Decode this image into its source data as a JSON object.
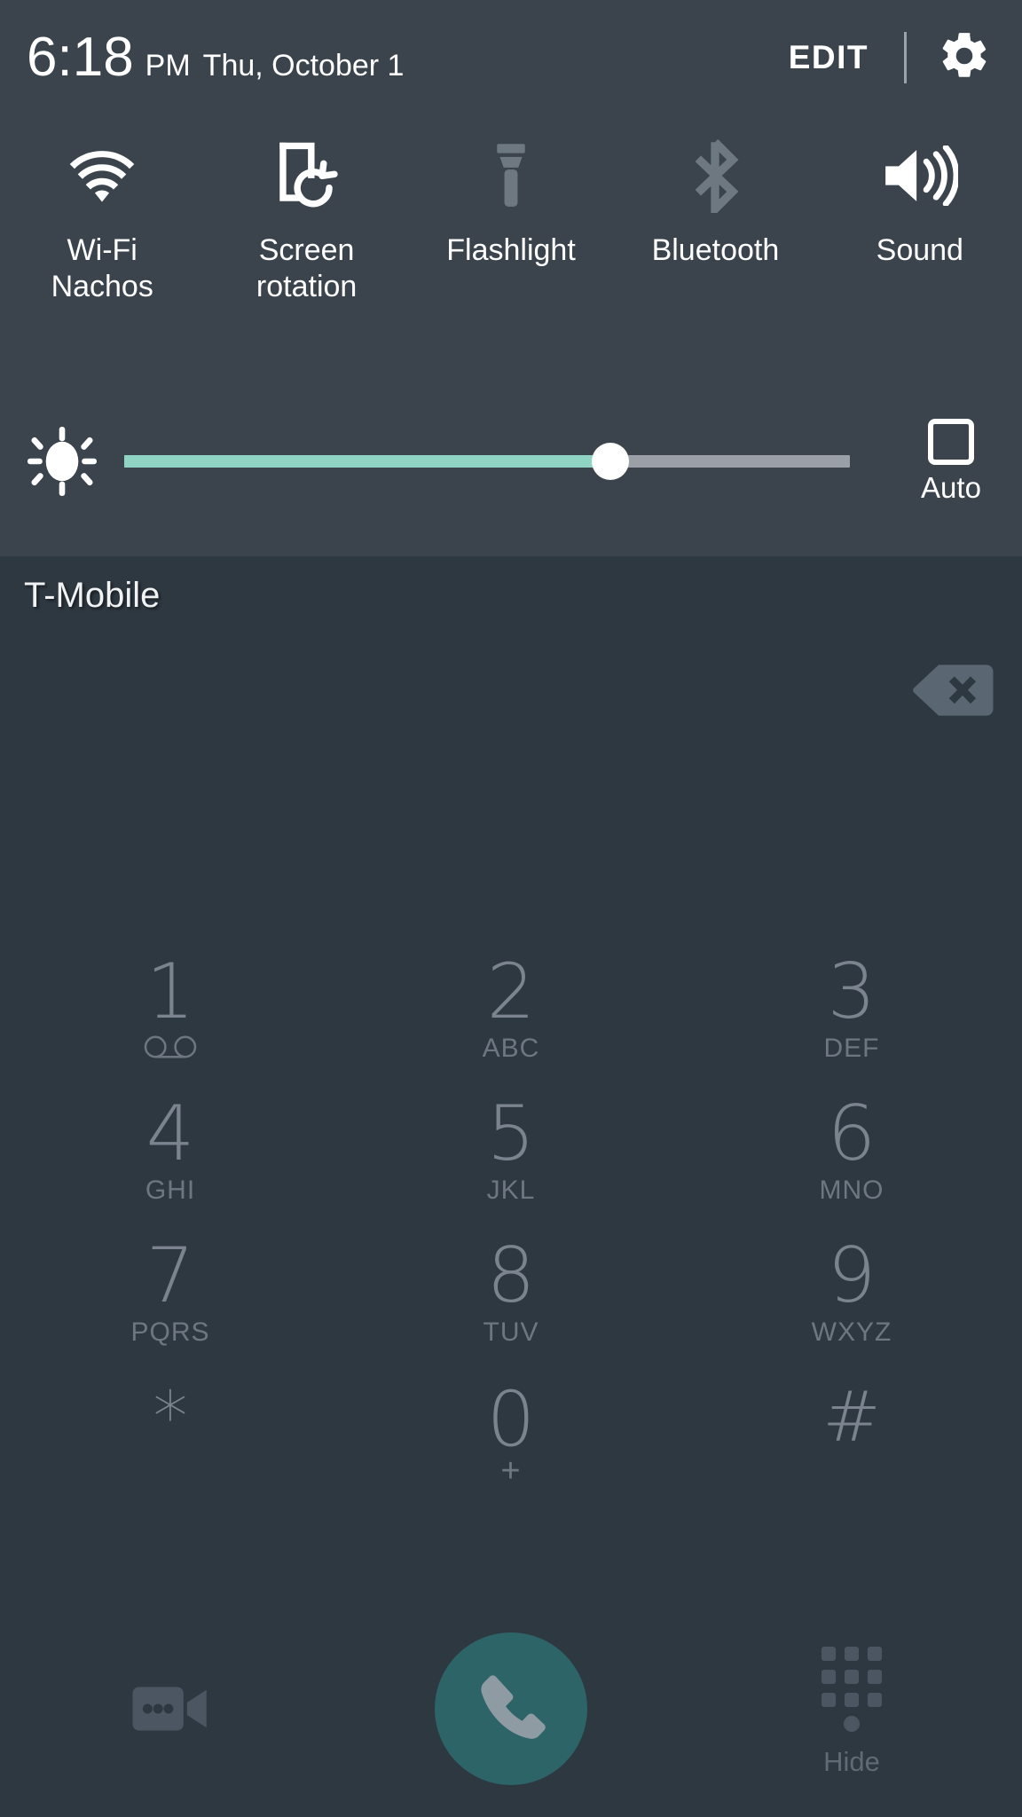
{
  "quick_settings": {
    "clock": {
      "time": "6:18",
      "ampm": "PM",
      "date": "Thu, October 1"
    },
    "edit_label": "EDIT",
    "settings_icon": "gear-icon",
    "tiles": [
      {
        "label_line1": "Wi-Fi",
        "label_line2": "Nachos",
        "icon": "wifi-icon",
        "state": "on",
        "color": "#ffffff"
      },
      {
        "label_line1": "Screen",
        "label_line2": "rotation",
        "icon": "screen-rotation-icon",
        "state": "on",
        "color": "#ffffff"
      },
      {
        "label_line1": "Flashlight",
        "label_line2": "",
        "icon": "flashlight-icon",
        "state": "off",
        "color": "#6e7881"
      },
      {
        "label_line1": "Bluetooth",
        "label_line2": "",
        "icon": "bluetooth-icon",
        "state": "off",
        "color": "#6e7881"
      },
      {
        "label_line1": "Sound",
        "label_line2": "",
        "icon": "volume-up-icon",
        "state": "on",
        "color": "#ffffff"
      }
    ],
    "brightness": {
      "icon": "brightness-icon",
      "value_percent": 67,
      "fill_color": "#90d4c3",
      "track_color": "#9aa0a6",
      "auto_label": "Auto",
      "auto_checked": false
    }
  },
  "dialer": {
    "carrier": "T-Mobile",
    "entered_number": "",
    "backspace_icon": "backspace-icon",
    "keys": [
      {
        "digit": "1",
        "sub": "",
        "sub_icon": "voicemail-icon"
      },
      {
        "digit": "2",
        "sub": "ABC",
        "sub_icon": ""
      },
      {
        "digit": "3",
        "sub": "DEF",
        "sub_icon": ""
      },
      {
        "digit": "4",
        "sub": "GHI",
        "sub_icon": ""
      },
      {
        "digit": "5",
        "sub": "JKL",
        "sub_icon": ""
      },
      {
        "digit": "6",
        "sub": "MNO",
        "sub_icon": ""
      },
      {
        "digit": "7",
        "sub": "PQRS",
        "sub_icon": ""
      },
      {
        "digit": "8",
        "sub": "TUV",
        "sub_icon": ""
      },
      {
        "digit": "9",
        "sub": "WXYZ",
        "sub_icon": ""
      },
      {
        "digit": "*",
        "sub": "",
        "sub_icon": ""
      },
      {
        "digit": "0",
        "sub": "+",
        "sub_icon": ""
      },
      {
        "digit": "#",
        "sub": "",
        "sub_icon": ""
      }
    ],
    "actions": {
      "video_call_icon": "video-call-icon",
      "call_icon": "phone-handset-icon",
      "call_button_color": "#2c6467",
      "hide_icon": "dialpad-grid-icon",
      "hide_label": "Hide"
    }
  },
  "colors": {
    "panel_background": "#3b444d",
    "dialer_background": "#2e3841",
    "accent_teal": "#2c6467",
    "slider_teal": "#90d4c3",
    "key_text": "#7b848e"
  }
}
